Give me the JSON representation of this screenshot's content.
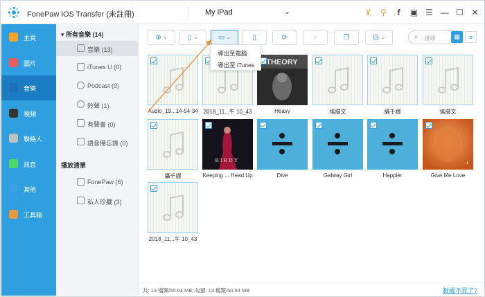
{
  "app": {
    "title": "FonePaw iOS Transfer (未註冊)"
  },
  "device": {
    "name": "My iPad"
  },
  "titlebar_icons": [
    "cart-icon",
    "key-icon",
    "facebook-icon",
    "chat-icon",
    "menu-icon",
    "minimize-icon",
    "maximize-icon",
    "close-icon"
  ],
  "sidebar": {
    "items": [
      {
        "label": "主頁",
        "icon": "home-icon",
        "color": "#f6a623"
      },
      {
        "label": "圖片",
        "icon": "photos-icon",
        "color": "#f05a5a"
      },
      {
        "label": "音樂",
        "icon": "music-icon",
        "color": "#1e6fb5"
      },
      {
        "label": "視頻",
        "icon": "video-icon",
        "color": "#333333"
      },
      {
        "label": "聯絡人",
        "icon": "contacts-icon",
        "color": "#c0c0c0"
      },
      {
        "label": "訊息",
        "icon": "messages-icon",
        "color": "#4cd964"
      },
      {
        "label": "其他",
        "icon": "other-icon",
        "color": "#3aa1e8"
      },
      {
        "label": "工具箱",
        "icon": "toolbox-icon",
        "color": "#e89a3a"
      }
    ],
    "active_index": 2
  },
  "categories": {
    "all_music_header": "所有音樂 (14)",
    "items": [
      {
        "label": "音樂 (13)",
        "icon": "music-note-icon"
      },
      {
        "label": "iTunes U (0)",
        "icon": "itunes-u-icon"
      },
      {
        "label": "Podcast (0)",
        "icon": "podcast-icon"
      },
      {
        "label": "鈴聲 (1)",
        "icon": "bell-icon"
      },
      {
        "label": "有聲書 (0)",
        "icon": "audiobook-icon"
      },
      {
        "label": "語音備忘錄 (0)",
        "icon": "voice-memo-icon"
      }
    ],
    "playlist_header": "播放清單",
    "playlists": [
      {
        "label": "FonePaw (6)",
        "icon": "playlist-icon"
      },
      {
        "label": "私人珍藏 (3)",
        "icon": "playlist-icon"
      }
    ]
  },
  "toolbar": {
    "buttons": [
      {
        "name": "add-button",
        "icon": "plus-circle-icon",
        "glyph": "⊕",
        "dropdown": true
      },
      {
        "name": "export-device-button",
        "icon": "export-device-icon",
        "glyph": "▯",
        "dropdown": true
      },
      {
        "name": "export-pc-button",
        "icon": "export-pc-icon",
        "glyph": "▭",
        "dropdown": true
      },
      {
        "name": "delete-button",
        "icon": "trash-icon",
        "glyph": "▯",
        "dropdown": false
      },
      {
        "name": "sync-button",
        "icon": "sync-icon",
        "glyph": "⟳",
        "dropdown": false
      },
      {
        "name": "ringtone-button",
        "icon": "bell-icon",
        "glyph": "♪",
        "dropdown": false
      },
      {
        "name": "copy-button",
        "icon": "copy-icon",
        "glyph": "❐",
        "dropdown": false
      },
      {
        "name": "toolbox-button",
        "icon": "toolbox-icon",
        "glyph": "⊟",
        "dropdown": true
      }
    ],
    "search_placeholder": "搜尋"
  },
  "export_menu": {
    "items": [
      "導出至電腦",
      "導出至 iTunes"
    ]
  },
  "songs": [
    {
      "title": "Audio_19...14-54-34",
      "art": "blank"
    },
    {
      "title": "2018_11...午 10_43",
      "art": "blank"
    },
    {
      "title": "Heavy",
      "art": "theory"
    },
    {
      "title": "搖擺文",
      "art": "blank"
    },
    {
      "title": "攝千娜",
      "art": "blank"
    },
    {
      "title": "搖擺文",
      "art": "blank"
    },
    {
      "title": "攝千娜",
      "art": "blank"
    },
    {
      "title": "Keeping ... Head Up",
      "art": "birdy"
    },
    {
      "title": "Dive",
      "art": "divide"
    },
    {
      "title": "Galway Girl",
      "art": "divide"
    },
    {
      "title": "Happier",
      "art": "divide"
    },
    {
      "title": "Give Me Love",
      "art": "plus"
    },
    {
      "title": "2018_11...午 10_43",
      "art": "blank"
    }
  ],
  "status": {
    "text": "共: 13 檔案/50.64 MB; 勾選: 13 檔案/50.64 MB",
    "link": "數據不見了?"
  }
}
